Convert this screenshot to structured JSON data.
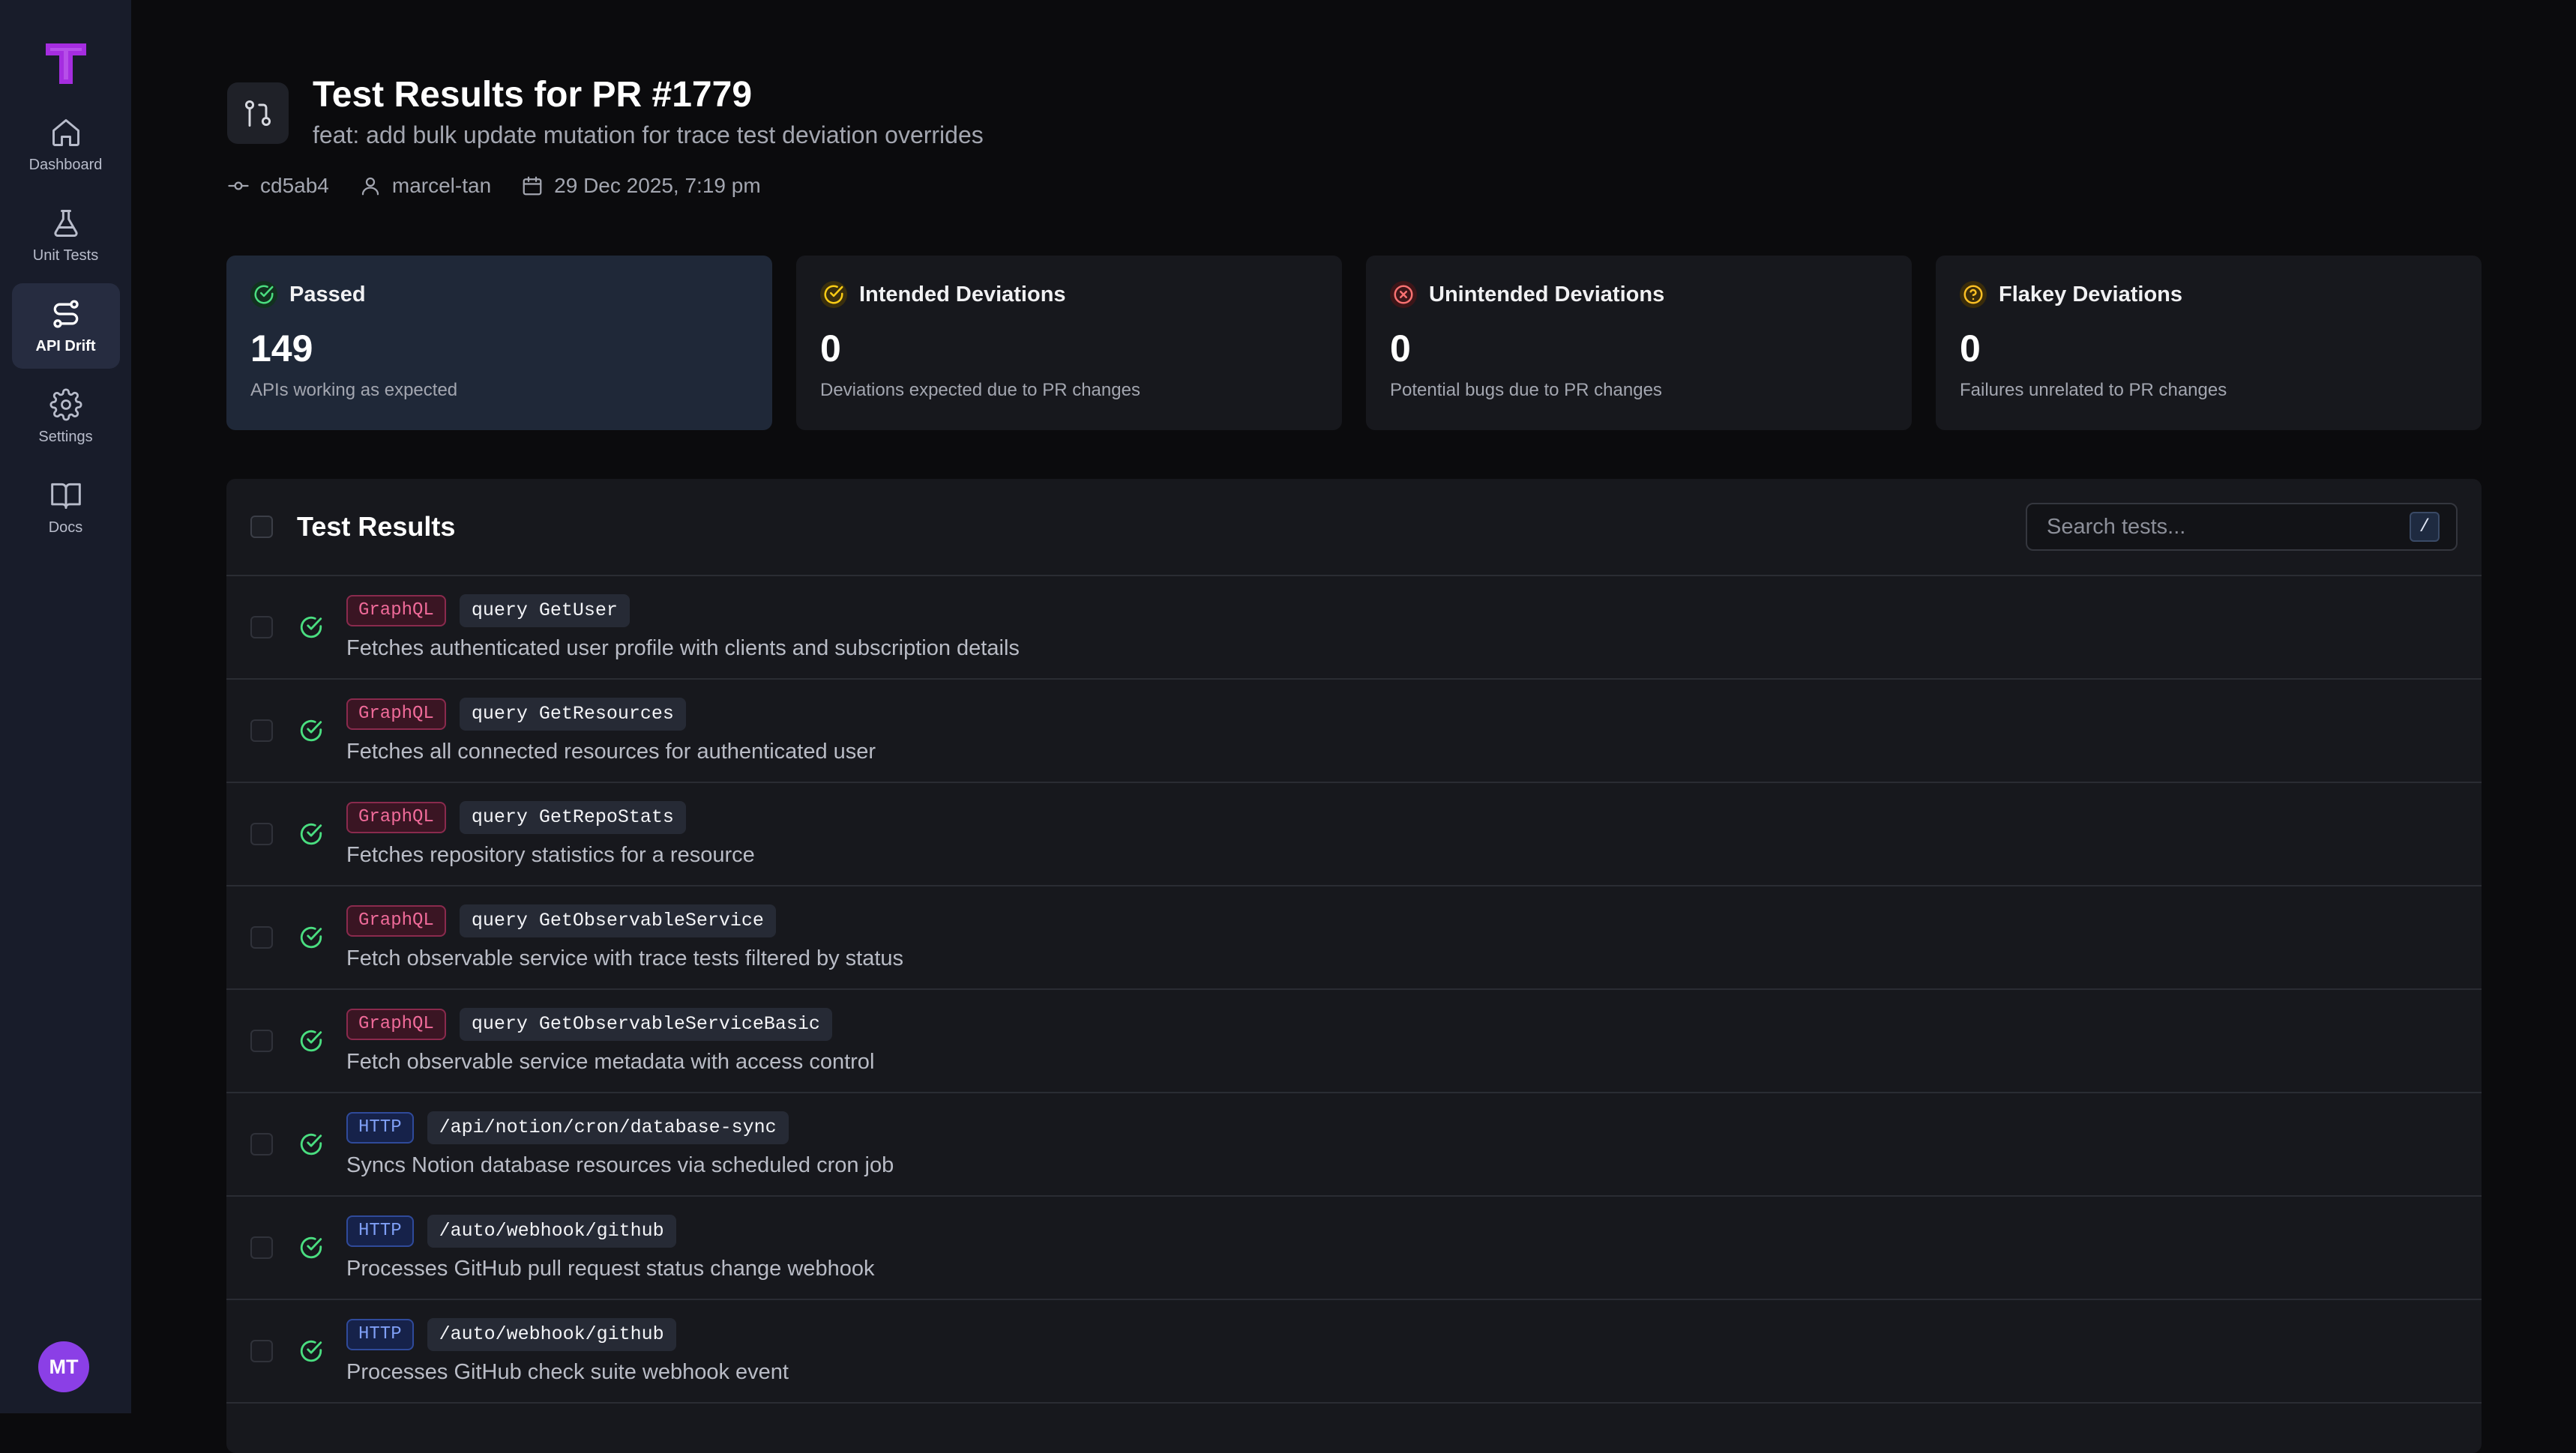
{
  "sidebar": {
    "items": [
      {
        "label": "Dashboard",
        "icon": "home-icon"
      },
      {
        "label": "Unit Tests",
        "icon": "flask-icon"
      },
      {
        "label": "API Drift",
        "icon": "route-icon",
        "active": true
      },
      {
        "label": "Settings",
        "icon": "gear-icon"
      },
      {
        "label": "Docs",
        "icon": "book-icon"
      }
    ],
    "avatar_initials": "MT",
    "brand_color": "#a52de0"
  },
  "header": {
    "title": "Test Results for PR #1779",
    "subtitle": "feat: add bulk update mutation for trace test deviation overrides",
    "commit": "cd5ab4",
    "author": "marcel-tan",
    "date": "29 Dec 2025, 7:19 pm"
  },
  "stats": [
    {
      "title": "Passed",
      "value": "149",
      "description": "APIs working as expected",
      "color": "#4ade80"
    },
    {
      "title": "Intended Deviations",
      "value": "0",
      "description": "Deviations expected due to PR changes",
      "color": "#facc15"
    },
    {
      "title": "Unintended Deviations",
      "value": "0",
      "description": "Potential bugs due to PR changes",
      "color": "#f87171"
    },
    {
      "title": "Flakey Deviations",
      "value": "0",
      "description": "Failures unrelated to PR changes",
      "color": "#fbbf24"
    }
  ],
  "results": {
    "title": "Test Results",
    "search_placeholder": "Search tests...",
    "search_shortcut": "/",
    "rows": [
      {
        "type": "GraphQL",
        "operation": "query GetUser",
        "description": "Fetches authenticated user profile with clients and subscription details",
        "status": "passed"
      },
      {
        "type": "GraphQL",
        "operation": "query GetResources",
        "description": "Fetches all connected resources for authenticated user",
        "status": "passed"
      },
      {
        "type": "GraphQL",
        "operation": "query GetRepoStats",
        "description": "Fetches repository statistics for a resource",
        "status": "passed"
      },
      {
        "type": "GraphQL",
        "operation": "query GetObservableService",
        "description": "Fetch observable service with trace tests filtered by status",
        "status": "passed"
      },
      {
        "type": "GraphQL",
        "operation": "query GetObservableServiceBasic",
        "description": "Fetch observable service metadata with access control",
        "status": "passed"
      },
      {
        "type": "HTTP",
        "operation": "/api/notion/cron/database-sync",
        "description": "Syncs Notion database resources via scheduled cron job",
        "status": "passed"
      },
      {
        "type": "HTTP",
        "operation": "/auto/webhook/github",
        "description": "Processes GitHub pull request status change webhook",
        "status": "passed"
      },
      {
        "type": "HTTP",
        "operation": "/auto/webhook/github",
        "description": "Processes GitHub check suite webhook event",
        "status": "passed"
      }
    ]
  }
}
